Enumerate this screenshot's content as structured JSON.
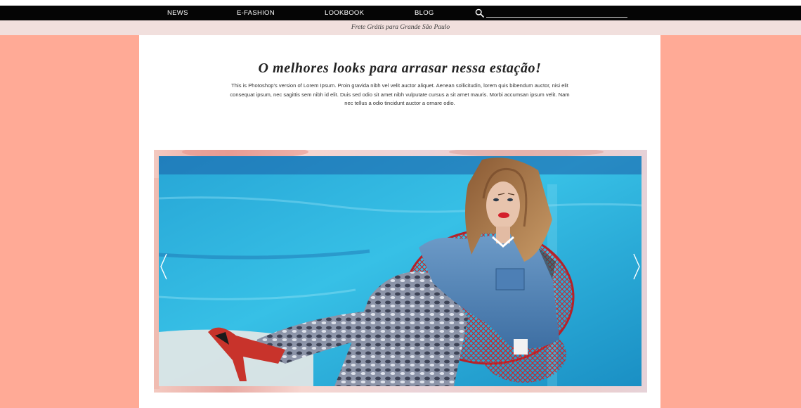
{
  "nav": {
    "items": [
      {
        "label": "NEWS"
      },
      {
        "label": "E-FASHION"
      },
      {
        "label": "LOOKBOOK"
      },
      {
        "label": "BLOG"
      }
    ],
    "search": {
      "placeholder": "",
      "icon": "search-icon"
    }
  },
  "promo": {
    "text": "Frete Grátis para Grande São Paulo"
  },
  "hero": {
    "title": "O melhores looks para arrasar nessa estação!",
    "body": "This is Photoshop's version  of Lorem Ipsum. Proin gravida nibh vel velit auctor aliquet. Aenean sollicitudin, lorem quis bibendum auctor, nisi elit consequat ipsum, nec sagittis sem nibh id elit. Duis sed odio sit amet nibh vulputate cursus a sit amet mauris. Morbi accumsan ipsum velit. Nam nec tellus a odio tincidunt auctor a ornare odio."
  },
  "slider": {
    "prev_icon": "chevron-left-icon",
    "next_icon": "chevron-right-icon"
  },
  "colors": {
    "page_background": "#ffaa96",
    "navbar": "#050505",
    "promo_bar": "#f1dfdd",
    "content": "#ffffff"
  }
}
